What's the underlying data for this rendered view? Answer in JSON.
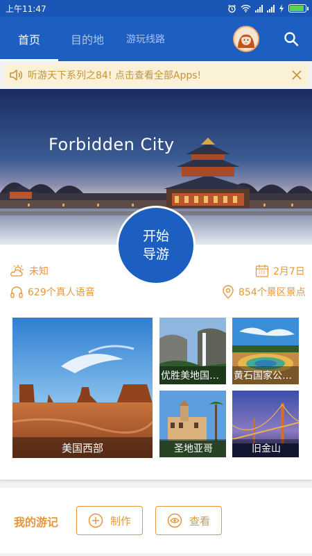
{
  "status_bar": {
    "time": "上午11:47"
  },
  "nav": {
    "tabs": [
      {
        "label": "首页"
      },
      {
        "label": "目的地"
      },
      {
        "label": "游玩线路"
      }
    ]
  },
  "notice": {
    "text": "听游天下系列之84! 点击查看全部Apps!"
  },
  "hero": {
    "title": "Forbidden City"
  },
  "start_button": {
    "line1": "开始",
    "line2": "导游"
  },
  "info": {
    "weather": "未知",
    "date": "2月7日",
    "voice_count": "629个真人语音",
    "spot_count": "854个景区景点"
  },
  "destinations": [
    {
      "label": "美国西部"
    },
    {
      "label": "优胜美地国…"
    },
    {
      "label": "黄石国家公…"
    },
    {
      "label": "圣地亚哥"
    },
    {
      "label": "旧金山"
    }
  ],
  "footer": {
    "title": "我的游记",
    "make_label": "制作",
    "view_label": "查看"
  },
  "colors": {
    "primary": "#1d5fc0",
    "accent": "#e8963a",
    "notice_bg": "#fbf1d6"
  }
}
